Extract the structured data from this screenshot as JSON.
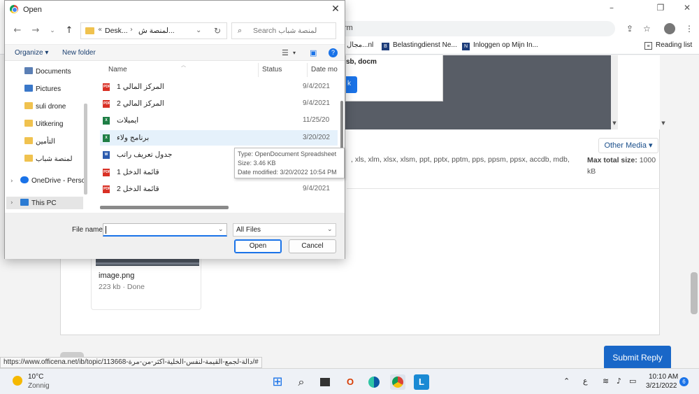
{
  "browser": {
    "address_fragment": "rm",
    "bookmarks": [
      "مجال...nl",
      "Belastingdienst Ne...",
      "Inloggen op Mijn In...",
      "Reading list"
    ],
    "window_controls": [
      "–",
      "❐",
      "✕"
    ]
  },
  "page": {
    "modal_fragment_text": "sb, docm",
    "modal_fragment_button": "k",
    "other_media_label": "Other Media ▾",
    "file_types_text": ", xls, xlm, xlsx, xlsm, ppt, pptx, pptm, pps, ppsm, ppsx, accdb, mdb,",
    "max_size_label": "Max total size:",
    "max_size_value": "1000 kB",
    "attachment_name": "image.png",
    "attachment_meta": "223 kb · Done",
    "submit_label": "Submit Reply",
    "status_url": "https://www.officena.net/ib/topic/113668-دالة-لجمع-القيمة-لنفس-الخلية-اكثر-من-مرة/#"
  },
  "dialog": {
    "title": "Open",
    "close_glyph": "✕",
    "breadcrumb": {
      "root": "«",
      "parent": "Desk...",
      "current": "لمنصة ش..."
    },
    "search_placeholder": "Search لمنصة شباب",
    "commands": {
      "organize": "Organize ▾",
      "new_folder": "New folder"
    },
    "nav_items": [
      {
        "label": "Documents",
        "icon_color": "#5b7fb5"
      },
      {
        "label": "Pictures",
        "icon_color": "#3a78c9"
      },
      {
        "label": "suli drone",
        "icon_color": "#f0c24f"
      },
      {
        "label": "Uitkering",
        "icon_color": "#f0c24f"
      },
      {
        "label": "التأمين",
        "icon_color": "#f0c24f"
      },
      {
        "label": "لمنصة شباب",
        "icon_color": "#f0c24f"
      },
      {
        "label": "OneDrive - Perso",
        "icon_color": "#1a73e8"
      },
      {
        "label": "This PC",
        "icon_color": "#2b7bd3"
      }
    ],
    "columns": {
      "name": "Name",
      "status": "Status",
      "date": "Date mo"
    },
    "files": [
      {
        "name": "المركز المالي 1",
        "type": "pdf",
        "date": "9/4/2021"
      },
      {
        "name": "المركز المالي 2",
        "type": "pdf",
        "date": "9/4/2021"
      },
      {
        "name": "ايميلات",
        "type": "xls",
        "date": "11/25/20"
      },
      {
        "name": "برنامج ولاء",
        "type": "xls",
        "date": "3/20/202"
      },
      {
        "name": "جدول تعريف راتب",
        "type": "doc",
        "date": ""
      },
      {
        "name": "قائمة الدخل 1",
        "type": "pdf",
        "date": ""
      },
      {
        "name": "قائمة الدخل 2",
        "type": "pdf",
        "date": "9/4/2021"
      }
    ],
    "tooltip": {
      "line1": "Type: OpenDocument Spreadsheet",
      "line2": "Size: 3.46 KB",
      "line3": "Date modified: 3/20/2022 10:54 PM"
    },
    "file_name_label": "File name:",
    "file_name_value": "",
    "file_type_value": "All Files",
    "open_label": "Open",
    "cancel_label": "Cancel"
  },
  "taskbar": {
    "temperature": "10°C",
    "weather": "Zonnig",
    "time": "10:10 AM",
    "date": "3/21/2022",
    "notifications": "6",
    "lang": "ع"
  }
}
